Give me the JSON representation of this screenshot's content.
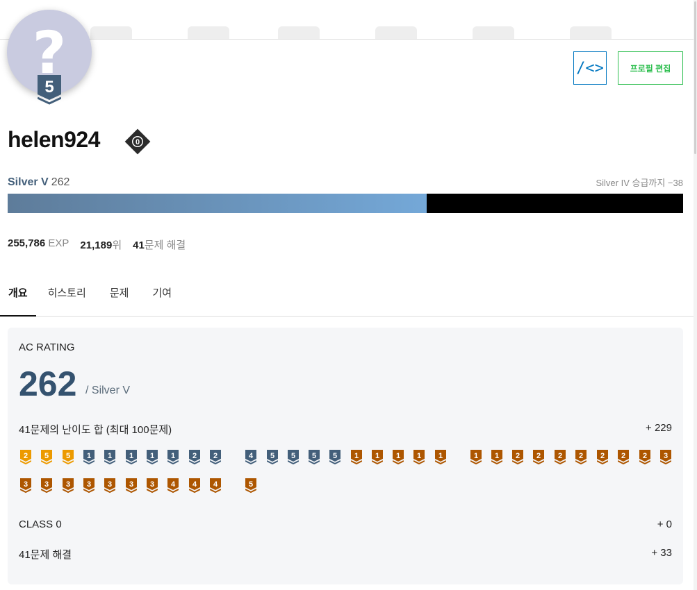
{
  "profile": {
    "avatar_glyph": "?",
    "avatar_tier_level": "5",
    "username": "helen924",
    "class_level": "0"
  },
  "buttons": {
    "code_label": "/<>",
    "edit_label": "프로필 편집"
  },
  "tier": {
    "name": "Silver V",
    "rating": "262",
    "next_text": "Silver IV 승급까지 −38",
    "progress_fraction": 0.62
  },
  "stats": {
    "exp_value": "255,786",
    "exp_unit": "EXP",
    "rank_value": "21,189",
    "rank_unit": "위",
    "solved_value": "41",
    "solved_unit": "문제 해결"
  },
  "tabs": [
    "개요",
    "히스토리",
    "문제",
    "기여"
  ],
  "overview": {
    "title": "AC RATING",
    "rating": "262",
    "rating_tier": "/ Silver V",
    "difficulty_label": "41문제의 난이도 합 (최대 100문제)",
    "difficulty_value": "+ 229",
    "class_label": "CLASS 0",
    "class_value": "+ 0",
    "solved_label": "41문제 해결",
    "solved_value": "+ 33"
  },
  "colors": {
    "gold": "#ec9a00",
    "silver": "#435f7a",
    "bronze": "#ad5600",
    "accent_blue": "#0076c0",
    "accent_green": "#2cbe4e"
  },
  "problem_badges": [
    {
      "tier": "gold",
      "level": "2"
    },
    {
      "tier": "gold",
      "level": "5"
    },
    {
      "tier": "gold",
      "level": "5"
    },
    {
      "tier": "silver",
      "level": "1"
    },
    {
      "tier": "silver",
      "level": "1"
    },
    {
      "tier": "silver",
      "level": "1"
    },
    {
      "tier": "silver",
      "level": "1"
    },
    {
      "tier": "silver",
      "level": "1"
    },
    {
      "tier": "silver",
      "level": "2"
    },
    {
      "tier": "silver",
      "level": "2"
    },
    {
      "tier": "silver",
      "level": "4"
    },
    {
      "tier": "silver",
      "level": "5"
    },
    {
      "tier": "silver",
      "level": "5"
    },
    {
      "tier": "silver",
      "level": "5"
    },
    {
      "tier": "silver",
      "level": "5"
    },
    {
      "tier": "bronze",
      "level": "1"
    },
    {
      "tier": "bronze",
      "level": "1"
    },
    {
      "tier": "bronze",
      "level": "1"
    },
    {
      "tier": "bronze",
      "level": "1"
    },
    {
      "tier": "bronze",
      "level": "1"
    },
    {
      "tier": "bronze",
      "level": "1"
    },
    {
      "tier": "bronze",
      "level": "1"
    },
    {
      "tier": "bronze",
      "level": "2"
    },
    {
      "tier": "bronze",
      "level": "2"
    },
    {
      "tier": "bronze",
      "level": "2"
    },
    {
      "tier": "bronze",
      "level": "2"
    },
    {
      "tier": "bronze",
      "level": "2"
    },
    {
      "tier": "bronze",
      "level": "2"
    },
    {
      "tier": "bronze",
      "level": "2"
    },
    {
      "tier": "bronze",
      "level": "3"
    },
    {
      "tier": "bronze",
      "level": "3"
    },
    {
      "tier": "bronze",
      "level": "3"
    },
    {
      "tier": "bronze",
      "level": "3"
    },
    {
      "tier": "bronze",
      "level": "3"
    },
    {
      "tier": "bronze",
      "level": "3"
    },
    {
      "tier": "bronze",
      "level": "3"
    },
    {
      "tier": "bronze",
      "level": "3"
    },
    {
      "tier": "bronze",
      "level": "4"
    },
    {
      "tier": "bronze",
      "level": "4"
    },
    {
      "tier": "bronze",
      "level": "4"
    },
    {
      "tier": "bronze",
      "level": "5"
    }
  ]
}
